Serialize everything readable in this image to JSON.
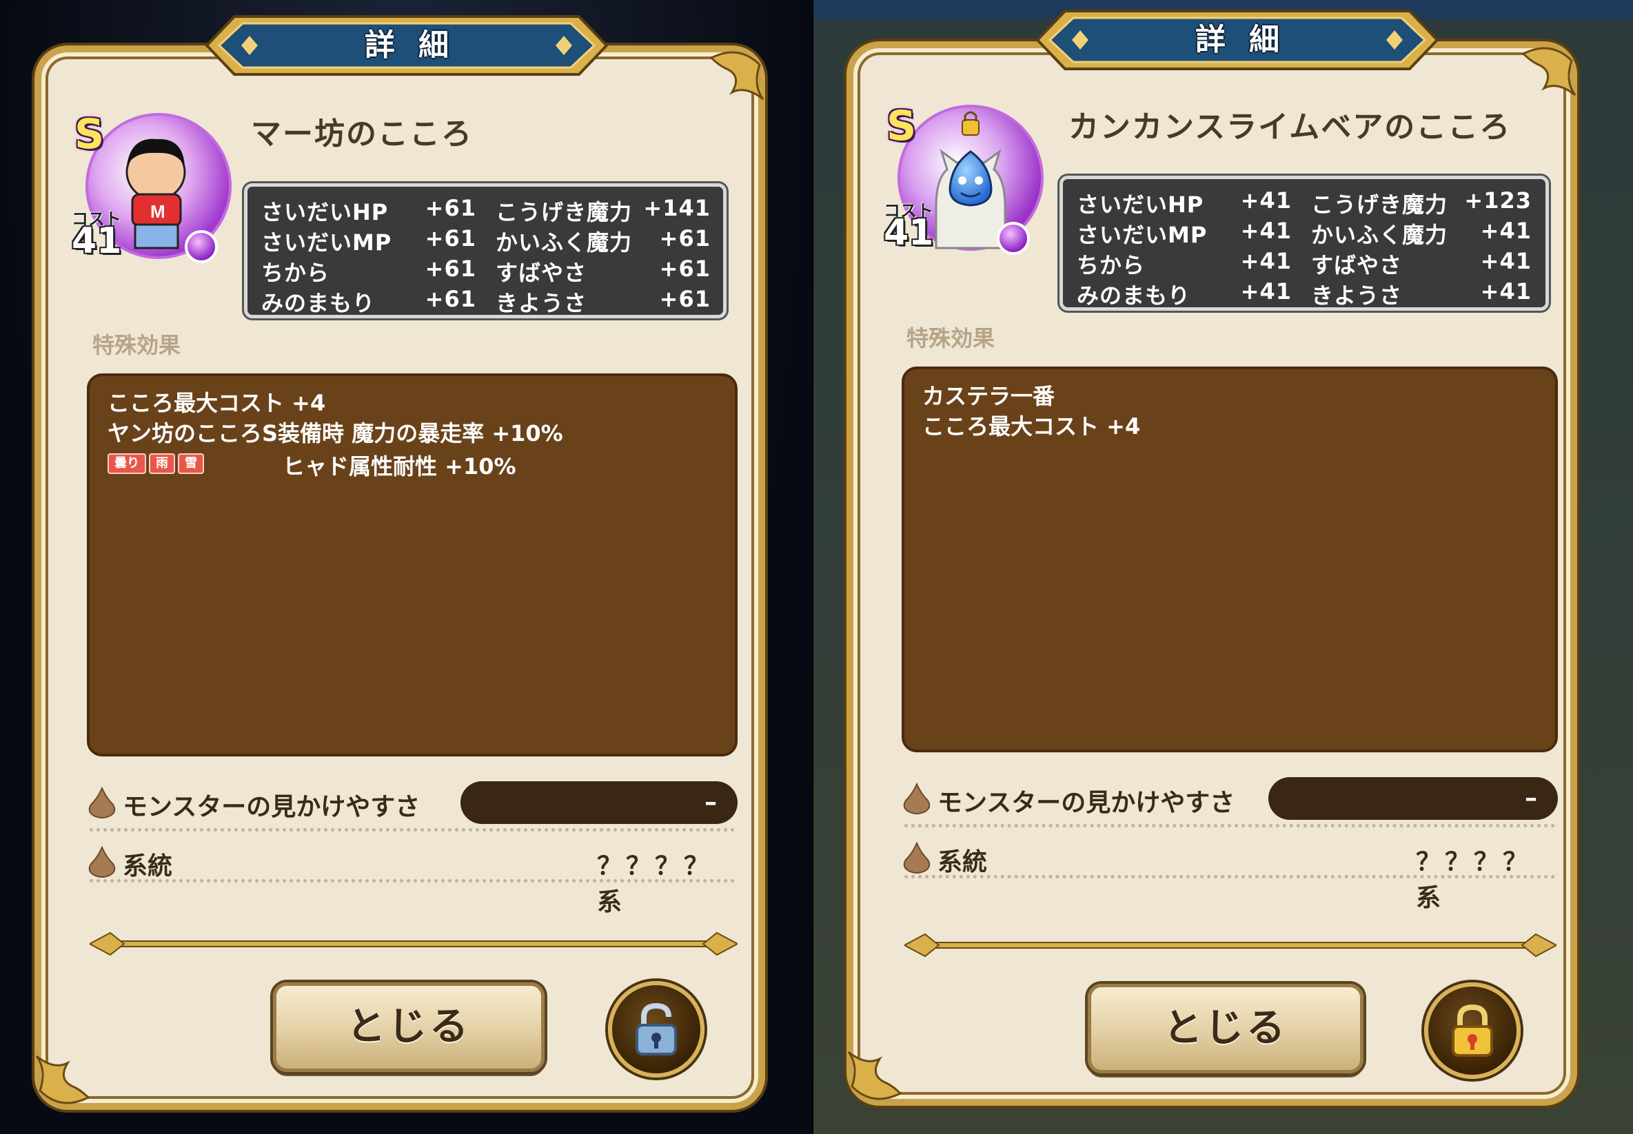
{
  "panels": [
    {
      "header_title": "詳細",
      "rank": "S",
      "cost_label": "コスト",
      "cost_value": "41",
      "name": "マー坊のこころ",
      "stats": [
        {
          "label": "さいだいHP",
          "value": "+61",
          "label2": "こうげき魔力",
          "value2": "+141"
        },
        {
          "label": "さいだいMP",
          "value": "+61",
          "label2": "かいふく魔力",
          "value2": "+61"
        },
        {
          "label": "ちから",
          "value": "+61",
          "label2": "すばやさ",
          "value2": "+61"
        },
        {
          "label": "みのまもり",
          "value": "+61",
          "label2": "きようさ",
          "value2": "+61"
        }
      ],
      "section_label": "特殊効果",
      "effects": [
        "こころ最大コスト +4",
        "ヤン坊のこころS装備時 魔力の暴走率 +10%"
      ],
      "weather_tags": [
        "曇り",
        "雨",
        "雪"
      ],
      "weather_effect": "ヒャド属性耐性 +10%",
      "visibility_label": "モンスターの見かけやすさ",
      "visibility_value": "–",
      "lineage_label": "系統",
      "lineage_value": "？？？？系",
      "close_label": "とじる",
      "lock_state": "unlocked"
    },
    {
      "header_title": "詳細",
      "rank": "S",
      "cost_label": "コスト",
      "cost_value": "41",
      "name": "カンカンスライムベアのこころ",
      "stats": [
        {
          "label": "さいだいHP",
          "value": "+41",
          "label2": "こうげき魔力",
          "value2": "+123"
        },
        {
          "label": "さいだいMP",
          "value": "+41",
          "label2": "かいふく魔力",
          "value2": "+41"
        },
        {
          "label": "ちから",
          "value": "+41",
          "label2": "すばやさ",
          "value2": "+41"
        },
        {
          "label": "みのまもり",
          "value": "+41",
          "label2": "きようさ",
          "value2": "+41"
        }
      ],
      "section_label": "特殊効果",
      "effects": [
        "カステラ一番",
        "こころ最大コスト +4"
      ],
      "visibility_label": "モンスターの見かけやすさ",
      "visibility_value": "–",
      "lineage_label": "系統",
      "lineage_value": "？？？？系",
      "close_label": "とじる",
      "lock_state": "locked"
    }
  ],
  "colors": {
    "panel_bg": "#efe6d4",
    "gold": "#caa24a",
    "banner_blue": "#1d4f78",
    "effect_bg": "#6a421a",
    "stat_bg": "#3a3a3a",
    "weather_tag": "#e8584a"
  }
}
